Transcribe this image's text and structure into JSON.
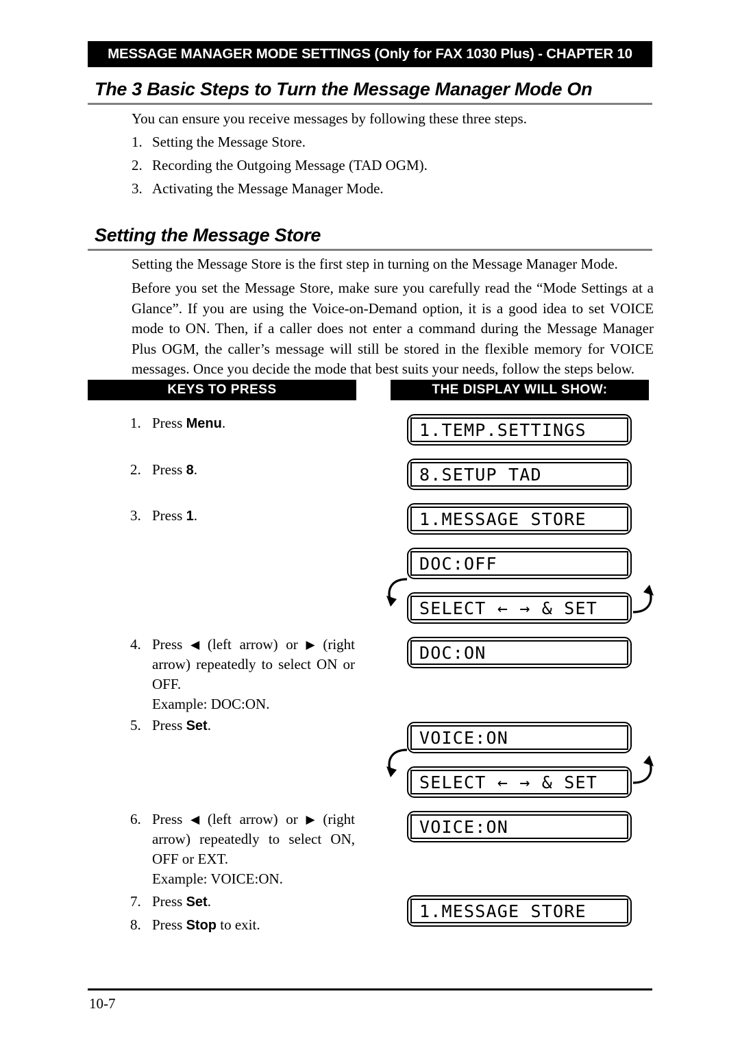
{
  "chapter_banner": "MESSAGE MANAGER MODE SETTINGS (Only for FAX 1030 Plus) - CHAPTER 10",
  "headings": {
    "main": "The 3 Basic Steps to Turn the Message Manager Mode On",
    "store": "Setting the Message Store"
  },
  "intro": {
    "lead": "You can ensure you receive messages by following these three steps.",
    "steps": [
      {
        "num": "1.",
        "text": "Setting the Message Store."
      },
      {
        "num": "2.",
        "text": "Recording the Outgoing Message (TAD OGM)."
      },
      {
        "num": "3.",
        "text": "Activating the Message Manager Mode."
      }
    ]
  },
  "store_section": {
    "intro": "Setting the Message Store is the first step in turning on the Message Manager Mode.",
    "paragraph": "Before you set the Message Store, make sure you carefully read the “Mode Settings at a Glance”. If you are using the Voice-on-Demand option, it is a good idea to set VOICE mode to ON. Then, if a caller does not enter a command during the Message Manager Plus OGM, the caller’s message will still be stored in the flexible memory for VOICE messages. Once you decide the mode that best suits your needs, follow the steps below."
  },
  "columns": {
    "keys_header": "KEYS TO PRESS",
    "display_header": "THE DISPLAY WILL SHOW:"
  },
  "keys_steps": {
    "s1": {
      "idx": "1.",
      "pre": "Press ",
      "key": "Menu",
      "post": "."
    },
    "s2": {
      "idx": "2.",
      "pre": "Press ",
      "key": "8",
      "post": "."
    },
    "s3": {
      "idx": "3.",
      "pre": "Press ",
      "key": "1",
      "post": "."
    },
    "s4": {
      "idx": "4.",
      "pre": "Press ",
      "left_arrow": "◀",
      "mid": " (left arrow) or ",
      "right_arrow": "▶",
      "post": " (right arrow) repeatedly to select ON or OFF.",
      "example": "Example: DOC:ON."
    },
    "s5": {
      "idx": "5.",
      "pre": "Press ",
      "key": "Set",
      "post": "."
    },
    "s6": {
      "idx": "6.",
      "pre": "Press ",
      "left_arrow": "◀",
      "mid": " (left arrow) or ",
      "right_arrow": "▶",
      "post": " (right arrow) repeatedly to select ON, OFF or EXT.",
      "example": "Example: VOICE:ON."
    },
    "s7": {
      "idx": "7.",
      "pre": "Press ",
      "key": "Set",
      "post": "."
    },
    "s8": {
      "idx": "8.",
      "pre": "Press ",
      "key": "Stop",
      "post": " to exit."
    }
  },
  "lcd_screens": [
    {
      "id": "lcd1",
      "text": "1.TEMP.SETTINGS"
    },
    {
      "id": "lcd2",
      "text": "8.SETUP TAD"
    },
    {
      "id": "lcd3",
      "text": "1.MESSAGE STORE"
    },
    {
      "id": "lcd4",
      "text": "DOC:OFF"
    },
    {
      "id": "lcd5",
      "text": "SELECT ← → & SET"
    },
    {
      "id": "lcd6",
      "text": "DOC:ON"
    },
    {
      "id": "lcd7",
      "text": "VOICE:ON"
    },
    {
      "id": "lcd8",
      "text": "SELECT ← → & SET"
    },
    {
      "id": "lcd9",
      "text": "VOICE:ON"
    },
    {
      "id": "lcd10",
      "text": "1.MESSAGE STORE"
    }
  ],
  "footer": {
    "page_number": "10-7"
  },
  "colors": {
    "banner_bg": "#000000",
    "banner_fg": "#ffffff",
    "rule_gray": "#808080",
    "ink": "#000000",
    "paper": "#ffffff"
  }
}
